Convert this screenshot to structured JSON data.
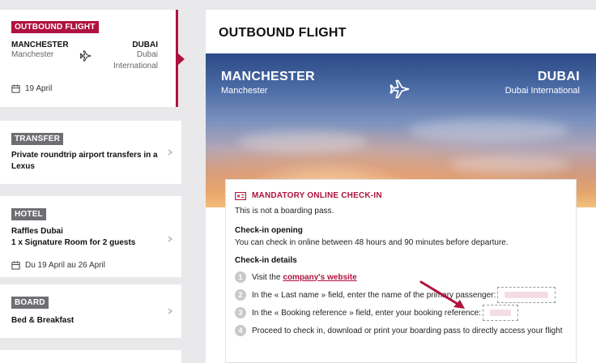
{
  "sidebar": {
    "flight": {
      "badge": "OUTBOUND FLIGHT",
      "from_city": "MANCHESTER",
      "from_name": "Manchester",
      "to_city": "DUBAI",
      "to_name_line1": "Dubai",
      "to_name_line2": "International",
      "date": "19 April"
    },
    "transfer": {
      "badge": "TRANSFER",
      "title": "Private roundtrip airport transfers in a Lexus"
    },
    "hotel": {
      "badge": "HOTEL",
      "title_line1": "Raffles Dubai",
      "title_line2": "1 x Signature Room for 2 guests",
      "dates": "Du 19 April au 26 April"
    },
    "board": {
      "badge": "BOARD",
      "title": "Bed & Breakfast"
    }
  },
  "main": {
    "title": "OUTBOUND FLIGHT",
    "hero": {
      "from_city": "MANCHESTER",
      "from_name": "Manchester",
      "to_city": "DUBAI",
      "to_name": "Dubai International"
    },
    "checkin": {
      "heading": "MANDATORY ONLINE CHECK-IN",
      "note": "This is not a boarding pass.",
      "opening_title": "Check-in opening",
      "opening_text": "You can check in online between 48 hours and 90 minutes before departure.",
      "details_title": "Check-in details",
      "steps": [
        {
          "num": "1",
          "text": "Visit the",
          "link": "company's website"
        },
        {
          "num": "2",
          "text": "In the « Last name » field, enter the name of the primary passenger:"
        },
        {
          "num": "3",
          "text": "In the « Booking reference » field, enter your booking reference:"
        },
        {
          "num": "4",
          "text": "Proceed to check in, download or print your boarding pass to directly access your flight"
        }
      ]
    }
  },
  "colors": {
    "accent": "#b0123f",
    "badge_gray": "#6f6f73",
    "background": "#e9e9ec"
  }
}
